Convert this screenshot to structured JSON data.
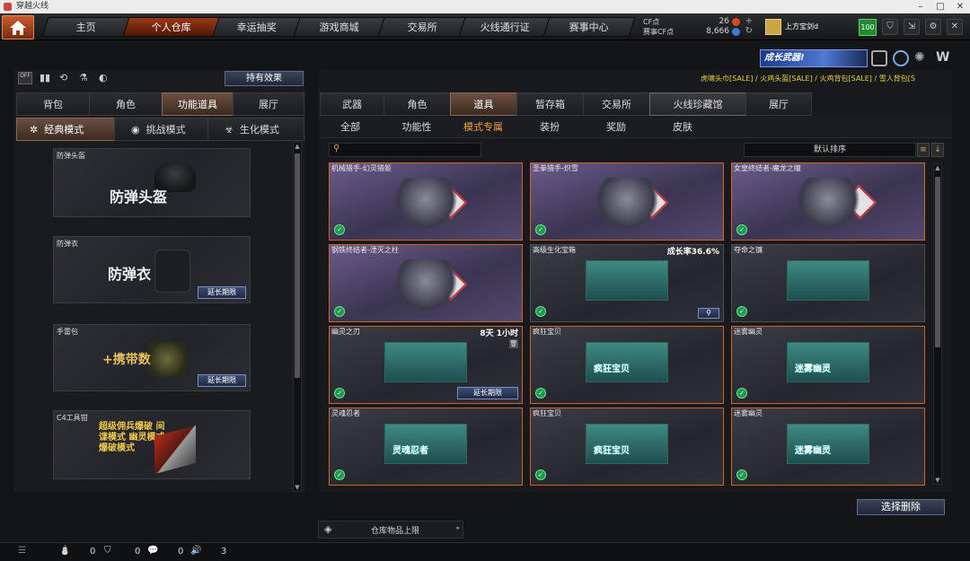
{
  "window": {
    "title": "穿越火线"
  },
  "nav": {
    "tabs": [
      "主页",
      "个人仓库",
      "幸运抽奖",
      "游戏商城",
      "交易所",
      "火线通行证",
      "赛事中心"
    ],
    "active_tab": "个人仓库"
  },
  "currency": {
    "cf_label": "CF点",
    "cf_value": "26",
    "match_label": "赛事CF点",
    "match_value": "8,666"
  },
  "user": {
    "name": "上方宝剑d",
    "level": "100"
  },
  "banner": {
    "title": "成长武器!",
    "ticker": "虎啸头巾[SALE] / 火鸡头盔[SALE] / 火鸡背包[SALE] / 雪人背包[S"
  },
  "left": {
    "effects_button": "持有效果",
    "tabs": [
      "背包",
      "角色",
      "功能道具",
      "展厅"
    ],
    "active_tab": "功能道具",
    "mode_tabs": [
      "经典模式",
      "挑战模式",
      "生化模式"
    ],
    "active_mode": "经典模式",
    "cards": [
      {
        "caption": "防弹头盔",
        "title": "防弹头盔",
        "button": ""
      },
      {
        "caption": "防弹衣",
        "title": "防弹衣",
        "button": "延长期限"
      },
      {
        "caption": "手雷包",
        "title": "+携带数",
        "button": "延长期限"
      },
      {
        "caption": "C4工具钳",
        "title": "超级佣兵爆破 间谍模式 幽灵模式 爆破模式",
        "button": ""
      }
    ]
  },
  "right": {
    "tabs": [
      "武器",
      "角色",
      "道具",
      "暂存箱",
      "交易所",
      "火线珍藏馆",
      "展厅"
    ],
    "active_tab": "道具",
    "subtabs": [
      "全部",
      "功能性",
      "模式专属",
      "装扮",
      "奖励",
      "皮肤"
    ],
    "active_subtab": "模式专属",
    "search_placeholder": "",
    "sort_label": "默认排序",
    "items": [
      {
        "name": "机械猎手-幻灵猎姬",
        "style": "purple"
      },
      {
        "name": "圣拳猎手-炽雪",
        "style": "purple"
      },
      {
        "name": "女皇终结者-魔龙之瞳",
        "style": "purple"
      },
      {
        "name": "钢铁终结者-湮灭之柱",
        "style": "purple"
      },
      {
        "name": "高级生化宝箱",
        "rate": "成长率36.6%",
        "style": "dark"
      },
      {
        "name": "夺命之镰",
        "style": "dark"
      },
      {
        "name": "幽灵之刃",
        "rate": "8天 1小时",
        "button": "延长期限",
        "style": "dark"
      },
      {
        "name": "疯狂宝贝",
        "art_label": "疯狂宝贝",
        "style": "dark"
      },
      {
        "name": "迷雾幽灵",
        "art_label": "迷雾幽灵",
        "style": "dark"
      },
      {
        "name": "灵魂忍者",
        "art_label": "灵魂忍者",
        "style": "dark"
      },
      {
        "name": "疯狂宝贝",
        "art_label": "疯狂宝贝",
        "style": "dark"
      },
      {
        "name": "迷雾幽灵",
        "art_label": "迷雾幽灵",
        "style": "dark"
      }
    ],
    "delete_button": "选择删除",
    "storage_label": "仓库物品上限"
  },
  "status": {
    "friends": "0",
    "guild": "0",
    "chat": "0",
    "volume": "3"
  },
  "colors": {
    "accent_orange": "#d26524",
    "active_tab": "#6a4f40",
    "button_blue": "#3b4d74"
  }
}
